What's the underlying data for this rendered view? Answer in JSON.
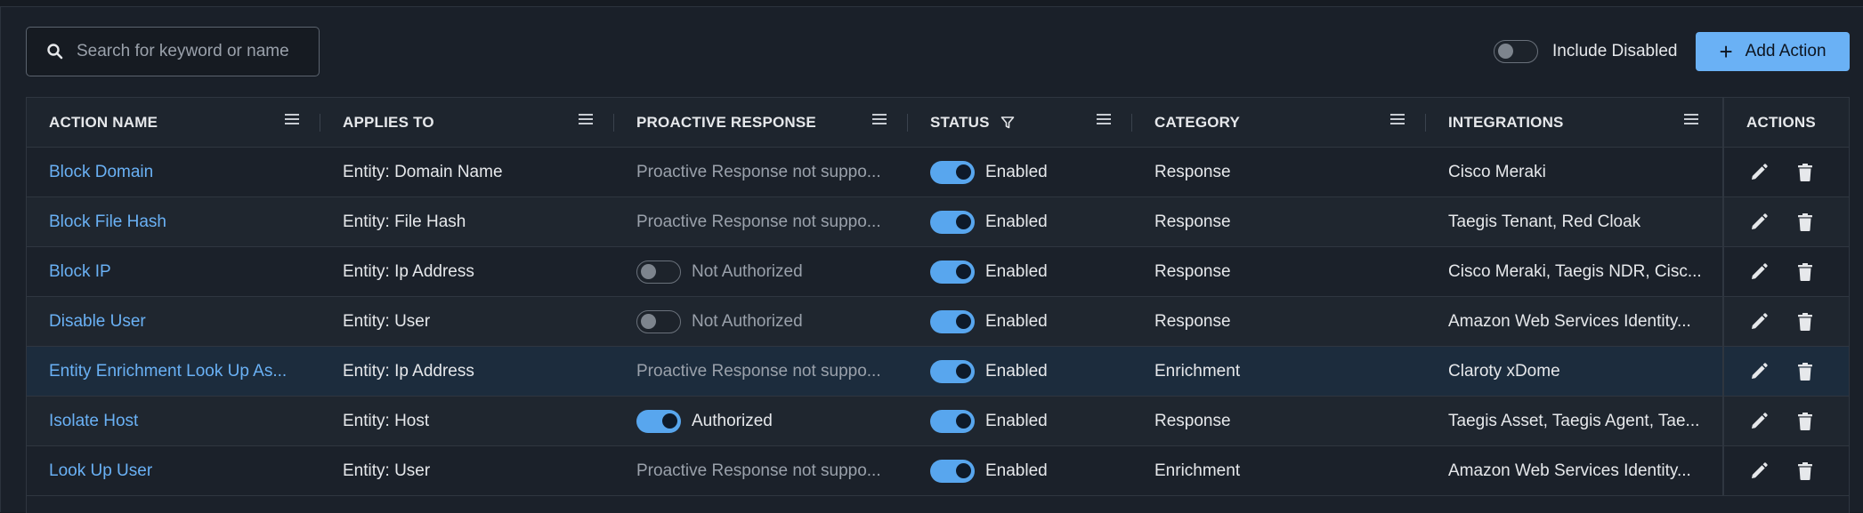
{
  "search": {
    "placeholder": "Search for keyword or name",
    "icon": "search-icon"
  },
  "include_disabled": {
    "label": "Include Disabled",
    "checked": false
  },
  "add_action": {
    "label": "Add Action",
    "icon": "plus-icon"
  },
  "columns": [
    {
      "key": "action_name",
      "label": "ACTION NAME",
      "has_menu": true
    },
    {
      "key": "applies_to",
      "label": "APPLIES TO",
      "has_menu": true
    },
    {
      "key": "proactive_response",
      "label": "PROACTIVE RESPONSE",
      "has_menu": true
    },
    {
      "key": "status",
      "label": "STATUS",
      "has_menu": true,
      "has_filter": true
    },
    {
      "key": "category",
      "label": "CATEGORY",
      "has_menu": true
    },
    {
      "key": "integrations",
      "label": "INTEGRATIONS",
      "has_menu": true
    },
    {
      "key": "actions",
      "label": "ACTIONS",
      "has_menu": false
    }
  ],
  "rows": [
    {
      "action_name": "Block Domain",
      "applies_to": "Entity: Domain Name",
      "proactive": {
        "kind": "text",
        "text": "Proactive Response not suppo..."
      },
      "status": {
        "on": true,
        "label": "Enabled"
      },
      "category": "Response",
      "integrations": "Cisco Meraki"
    },
    {
      "action_name": "Block File Hash",
      "applies_to": "Entity: File Hash",
      "proactive": {
        "kind": "text",
        "text": "Proactive Response not suppo..."
      },
      "status": {
        "on": true,
        "label": "Enabled"
      },
      "category": "Response",
      "integrations": "Taegis Tenant, Red Cloak"
    },
    {
      "action_name": "Block IP",
      "applies_to": "Entity: Ip Address",
      "proactive": {
        "kind": "toggle",
        "on": false,
        "text": "Not Authorized"
      },
      "status": {
        "on": true,
        "label": "Enabled"
      },
      "category": "Response",
      "integrations": "Cisco Meraki, Taegis NDR, Cisc..."
    },
    {
      "action_name": "Disable User",
      "applies_to": "Entity: User",
      "proactive": {
        "kind": "toggle",
        "on": false,
        "text": "Not Authorized"
      },
      "status": {
        "on": true,
        "label": "Enabled"
      },
      "category": "Response",
      "integrations": "Amazon Web Services Identity..."
    },
    {
      "action_name": "Entity Enrichment Look Up As...",
      "applies_to": "Entity: Ip Address",
      "proactive": {
        "kind": "text",
        "text": "Proactive Response not suppo..."
      },
      "status": {
        "on": true,
        "label": "Enabled"
      },
      "category": "Enrichment",
      "integrations": "Claroty xDome"
    },
    {
      "action_name": "Isolate Host",
      "applies_to": "Entity: Host",
      "proactive": {
        "kind": "toggle",
        "on": true,
        "text": "Authorized"
      },
      "status": {
        "on": true,
        "label": "Enabled"
      },
      "category": "Response",
      "integrations": "Taegis Asset, Taegis Agent, Tae..."
    },
    {
      "action_name": "Look Up User",
      "applies_to": "Entity: User",
      "proactive": {
        "kind": "text",
        "text": "Proactive Response not suppo..."
      },
      "status": {
        "on": true,
        "label": "Enabled"
      },
      "category": "Enrichment",
      "integrations": "Amazon Web Services Identity..."
    }
  ],
  "colors": {
    "accent": "#6ab1f5",
    "toggle_on": "#58a6ee",
    "background": "#1a2029",
    "muted_text": "#9aa1ab"
  }
}
